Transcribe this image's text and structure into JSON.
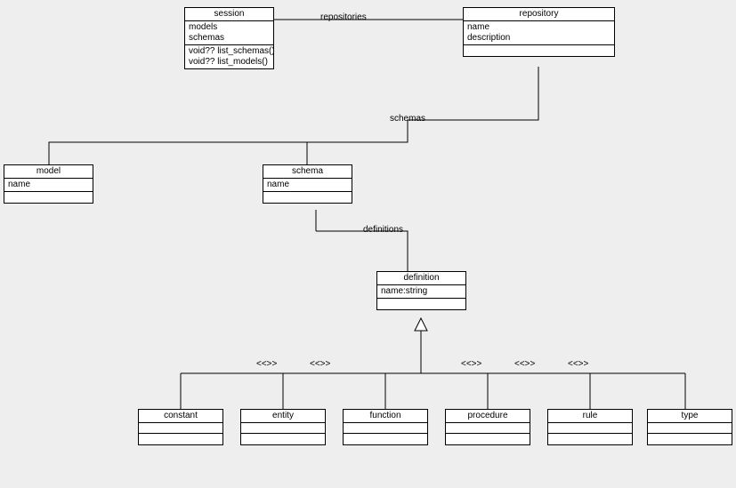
{
  "classes": {
    "session": {
      "title": "session",
      "attrs": [
        "models",
        "schemas"
      ],
      "ops": [
        "void?? list_schemas()",
        "void?? list_models()"
      ]
    },
    "repository": {
      "title": "repository",
      "attrs": [
        "name",
        "description"
      ]
    },
    "model": {
      "title": "model",
      "attrs": [
        "name"
      ]
    },
    "schema": {
      "title": "schema",
      "attrs": [
        "name"
      ]
    },
    "definition": {
      "title": "definition",
      "attrs": [
        "name:string"
      ]
    },
    "constant": {
      "title": "constant"
    },
    "entity": {
      "title": "entity"
    },
    "function": {
      "title": "function"
    },
    "procedure": {
      "title": "procedure"
    },
    "rule": {
      "title": "rule"
    },
    "type": {
      "title": "type"
    }
  },
  "labels": {
    "repositories": "repositories",
    "schemas": "schemas",
    "definitions": "definitions"
  },
  "stereotypes": {
    "s1": "<<>>",
    "s2": "<<>>",
    "s3": "<<>>",
    "s4": "<<>>",
    "s5": "<<>>"
  }
}
